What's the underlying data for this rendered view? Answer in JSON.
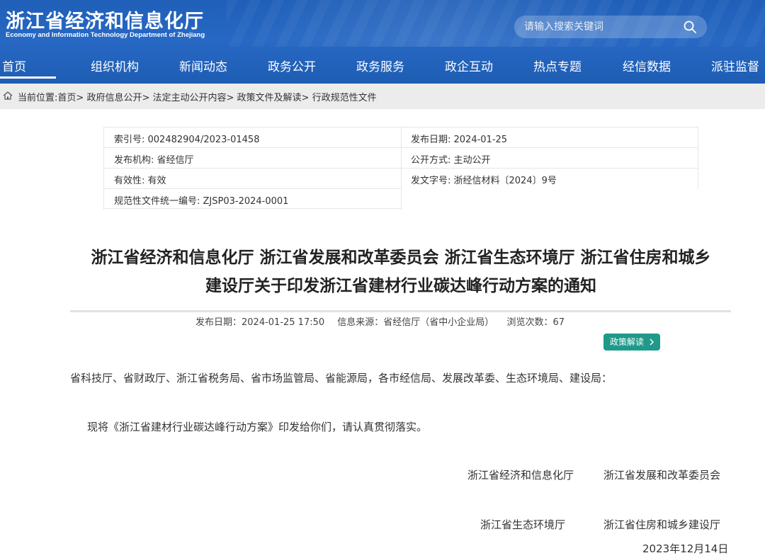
{
  "header": {
    "logo_cn": "浙江省经济和信息化厅",
    "logo_en": "Economy and Information Technology Department of Zhejiang",
    "search_placeholder": "请输入搜索关键词",
    "search_icon": "search-icon"
  },
  "nav": {
    "items": [
      "首页",
      "组织机构",
      "新闻动态",
      "政务公开",
      "政务服务",
      "政企互动",
      "热点专题",
      "经信数据",
      "派驻监督"
    ],
    "active": "首页"
  },
  "breadcrumb": {
    "prefix": "当前位置:",
    "items": [
      "首页",
      "政府信息公开",
      "法定主动公开内容",
      "政策文件及解读",
      "行政规范性文件"
    ]
  },
  "info": {
    "index_no": "索引号: 002482904/2023-01458",
    "publish_date": "发布日期: 2024-01-25",
    "publisher": "发布机构: 省经信厅",
    "open_method": "公开方式: 主动公开",
    "validity": "有效性: 有效",
    "doc_no": "发文字号: 浙经信材料〔2024〕9号",
    "unified_no": "规范性文件统一编号: ZJSP03-2024-0001"
  },
  "article": {
    "title_line1": "浙江省经济和信息化厅 浙江省发展和改革委员会 浙江省生态环境厅 浙江省住房和城乡",
    "title_line2": "建设厅关于印发浙江省建材行业碳达峰行动方案的通知",
    "meta_date": "发布日期：2024-01-25 17:50",
    "meta_source": "信息来源：省经信厅（省中小企业局）",
    "meta_views": "浏览次数：67",
    "policy_button": "政策解读",
    "recipients": "省科技厅、省财政厅、浙江省税务局、省市场监管局、省能源局，各市经信局、发展改革委、生态环境局、建设局：",
    "body": "现将《浙江省建材行业碳达峰行动方案》印发给你们，请认真贯彻落实。",
    "sign1a": "浙江省经济和信息化厅",
    "sign1b": "浙江省发展和改革委员会",
    "sign2a": "浙江省生态环境厅",
    "sign2b": "浙江省住房和城乡建设厅",
    "date": "2023年12月14日"
  },
  "colors": {
    "header_blue": "#2768c4",
    "policy_button": "#1e9a8a",
    "breadcrumb_bg": "#ececec"
  }
}
